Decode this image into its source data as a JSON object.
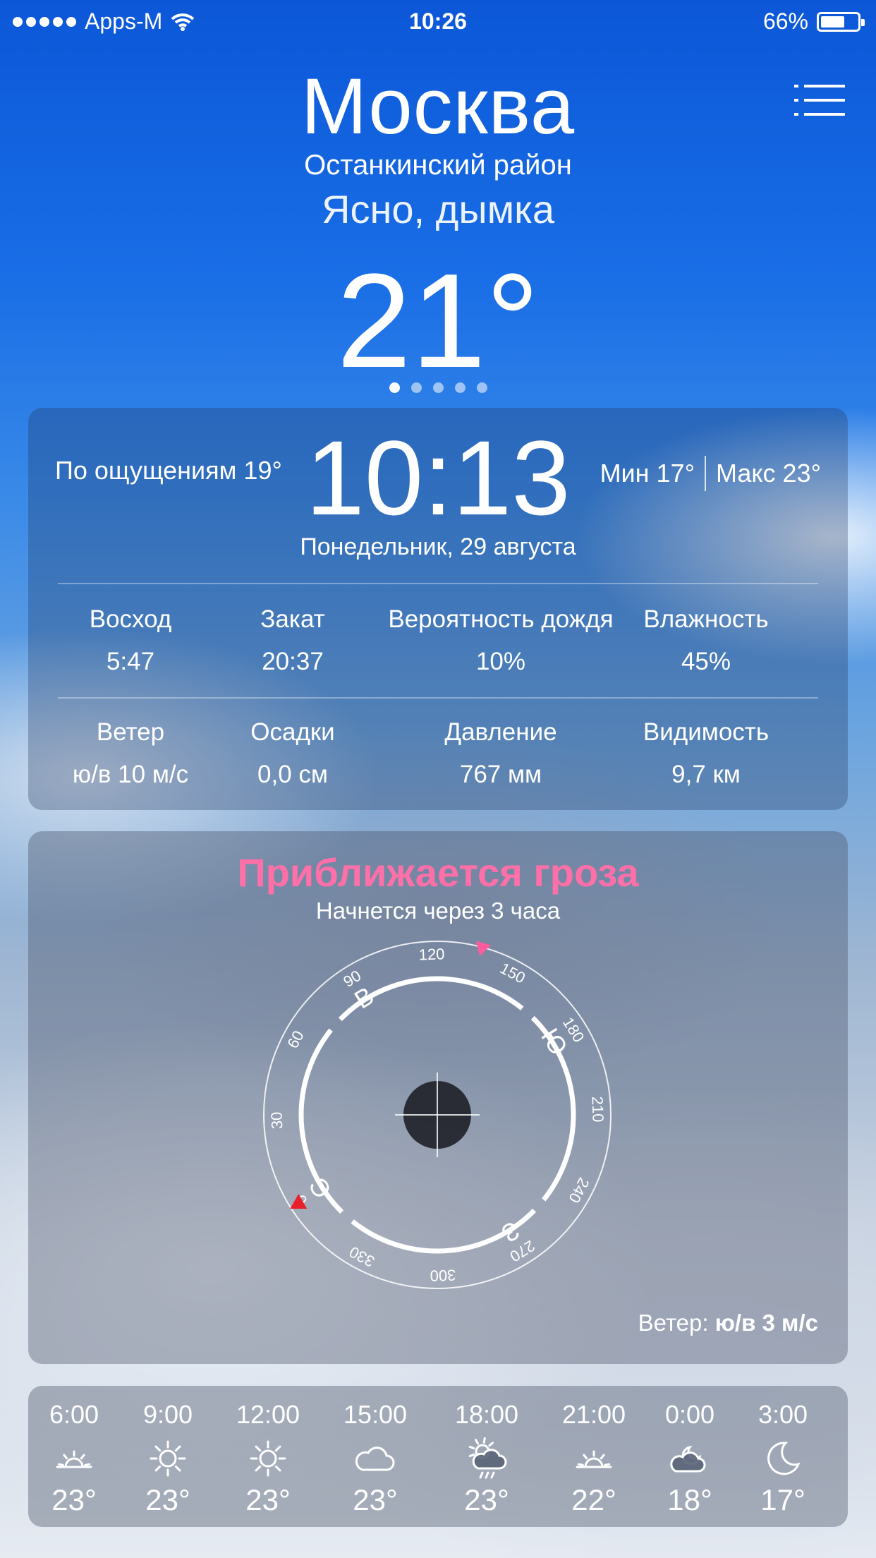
{
  "status_bar": {
    "carrier": "Apps-M",
    "time": "10:26",
    "battery": "66%",
    "battery_level": 0.66
  },
  "header": {
    "city": "Москва",
    "district": "Останкинский район",
    "condition": "Ясно, дымка",
    "temperature": "21°"
  },
  "pager": {
    "count": 5,
    "active": 0
  },
  "now": {
    "feels_like": "По ощущениям 19°",
    "time": "10:13",
    "min": "Мин 17°",
    "max": "Макс 23°",
    "date": "Понедельник, 29 августа"
  },
  "stats": [
    {
      "label": "Восход",
      "value": "5:47"
    },
    {
      "label": "Закат",
      "value": "20:37"
    },
    {
      "label": "Вероятность дождя",
      "value": "10%"
    },
    {
      "label": "Влажность",
      "value": "45%"
    },
    {
      "label": "Ветер",
      "value": "ю/в 10 м/с"
    },
    {
      "label": "Осадки",
      "value": "0,0 см"
    },
    {
      "label": "Давление",
      "value": "767 мм"
    },
    {
      "label": "Видимость",
      "value": "9,7 км"
    }
  ],
  "storm": {
    "title": "Приближается гроза",
    "subtitle": "Начнется через 3 часа",
    "wind_prefix": "Ветер: ",
    "wind_value": "ю/в 3 м/с",
    "compass_ticks": [
      "0",
      "30",
      "60",
      "90",
      "120",
      "150",
      "180",
      "210",
      "240",
      "270",
      "300",
      "330"
    ],
    "cardinals": [
      "С",
      "В",
      "Ю",
      "З"
    ],
    "colors": {
      "title": "#ff6fa8",
      "storm_marker": "#ff5c9e",
      "wind_marker": "#e8202a"
    }
  },
  "forecast": [
    {
      "time": "6:00",
      "icon": "sunrise-icon",
      "temp": "23°"
    },
    {
      "time": "9:00",
      "icon": "sun-icon",
      "temp": "23°"
    },
    {
      "time": "12:00",
      "icon": "sun-icon",
      "temp": "23°"
    },
    {
      "time": "15:00",
      "icon": "cloud-icon",
      "temp": "23°"
    },
    {
      "time": "18:00",
      "icon": "sun-cloud-rain-icon",
      "temp": "23°"
    },
    {
      "time": "21:00",
      "icon": "sunset-icon",
      "temp": "22°"
    },
    {
      "time": "0:00",
      "icon": "moon-cloud-icon",
      "temp": "18°"
    },
    {
      "time": "3:00",
      "icon": "moon-icon",
      "temp": "17°"
    }
  ]
}
